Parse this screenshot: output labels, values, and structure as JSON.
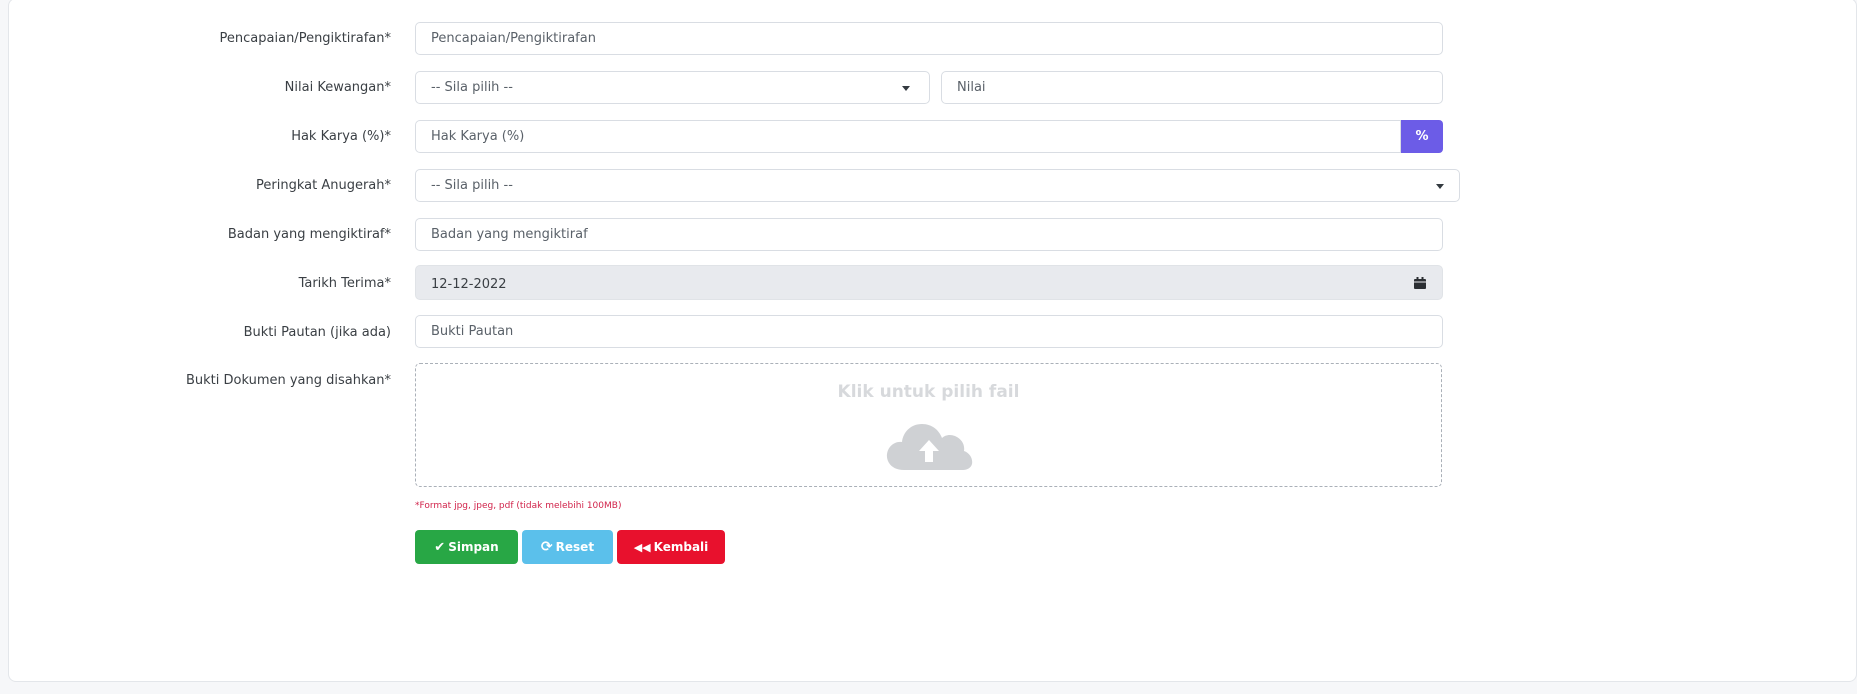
{
  "form": {
    "fields": [
      {
        "label": "Pencapaian/Pengiktirafan*",
        "placeholder": "Pencapaian/Pengiktirafan"
      },
      {
        "label": "Nilai Kewangan*",
        "select_value": "-- Sila pilih --",
        "placeholder": "Nilai"
      },
      {
        "label": "Hak Karya (%)*",
        "placeholder": "Hak Karya (%)",
        "addon": "%"
      },
      {
        "label": "Peringkat Anugerah*",
        "select_value": "-- Sila pilih --"
      },
      {
        "label": "Badan yang mengiktiraf*",
        "placeholder": "Badan yang mengiktiraf"
      },
      {
        "label": "Tarikh Terima*",
        "value": "12-12-2022"
      },
      {
        "label": "Bukti Pautan (jika ada)",
        "placeholder": "Bukti Pautan"
      },
      {
        "label": "Bukti Dokumen yang disahkan*"
      }
    ],
    "dropzone": {
      "title": "Klik untuk pilih fail",
      "icon": "cloud-upload-icon"
    },
    "format_hint": "*Format jpg, jpeg, pdf (tidak melebihi 100MB)"
  },
  "buttons": {
    "save": {
      "label": "Simpan",
      "icon": "check-icon",
      "color": "#28a745"
    },
    "reset": {
      "label": "Reset",
      "icon": "refresh-icon",
      "color": "#5bc0eb"
    },
    "back": {
      "label": "Kembali",
      "icon": "double-left-icon",
      "color": "#e8112d"
    }
  },
  "colors": {
    "percent_addon": "#6c5ce7",
    "disabled_bg": "#e8eaee",
    "hint_text": "#d1244b"
  }
}
